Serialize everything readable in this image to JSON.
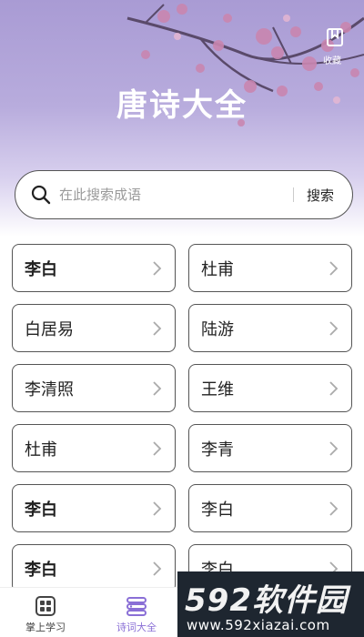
{
  "header": {
    "title": "唐诗大全",
    "favorite_label": "收藏"
  },
  "search": {
    "placeholder": "在此搜索成语",
    "button_label": "搜索"
  },
  "poets": [
    {
      "name": "李白",
      "bold": true
    },
    {
      "name": "杜甫",
      "bold": false
    },
    {
      "name": "白居易",
      "bold": false
    },
    {
      "name": "陆游",
      "bold": false
    },
    {
      "name": "李清照",
      "bold": false
    },
    {
      "name": "王维",
      "bold": false
    },
    {
      "name": "杜甫",
      "bold": false
    },
    {
      "name": "李青",
      "bold": false
    },
    {
      "name": "李白",
      "bold": true
    },
    {
      "name": "李白",
      "bold": false
    },
    {
      "name": "李白",
      "bold": true
    },
    {
      "name": "李白",
      "bold": false
    }
  ],
  "tabbar": {
    "tabs": [
      {
        "label": "掌上学习",
        "icon": "grid-icon",
        "active": false
      },
      {
        "label": "诗词大全",
        "icon": "book-stack-icon",
        "active": true
      }
    ]
  },
  "watermark": {
    "brand": "592软件园",
    "url": "www.592xiazai.com"
  },
  "colors": {
    "accent": "#8a6fd6",
    "header_top": "#a99bd4",
    "watermark_bg": "#1e2630"
  }
}
